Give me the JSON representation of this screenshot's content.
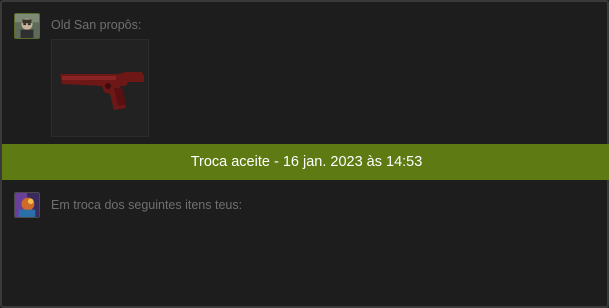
{
  "offer": {
    "partner_label": "Old San propôs:",
    "partner_avatar_icon": "user-avatar-icon",
    "item": {
      "icon": "pistol-item-icon",
      "color": "#7a1a1a"
    }
  },
  "status": {
    "text": "Troca aceite - 16 jan. 2023 às 14:53",
    "color": "#5d7a13"
  },
  "return": {
    "label": "Em troca dos seguintes itens teus:",
    "self_avatar_icon": "user-avatar-icon"
  }
}
